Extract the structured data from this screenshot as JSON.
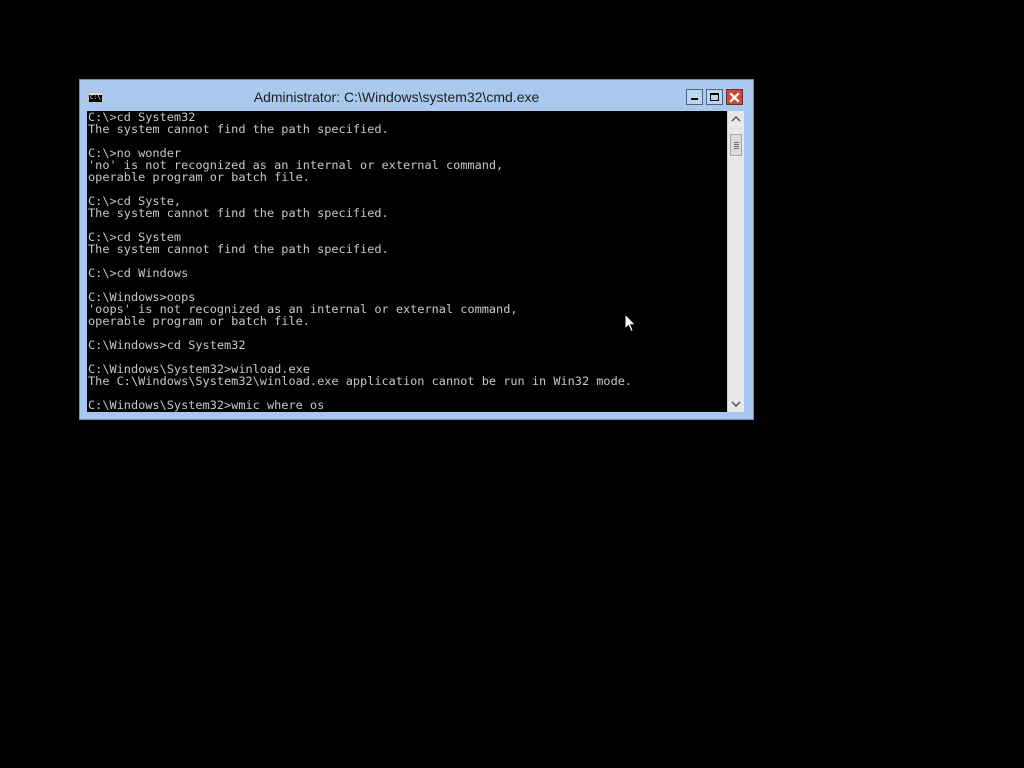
{
  "window": {
    "title": "Administrator: C:\\Windows\\system32\\cmd.exe",
    "icon_text": "C:\\"
  },
  "icons": {
    "app": "command-prompt-icon",
    "minimize": "minimize-icon",
    "maximize": "maximize-icon",
    "close": "close-icon",
    "scroll_up": "chevron-up-icon",
    "scroll_down": "chevron-down-icon",
    "cursor": "mouse-pointer-icon"
  },
  "colors": {
    "title_bar": "#a9caee",
    "close_button": "#c74a3a",
    "console_background": "#000000",
    "console_text": "#c8c8c8"
  },
  "console": {
    "lines": [
      "C:\\>cd System32",
      "The system cannot find the path specified.",
      "",
      "C:\\>no wonder",
      "'no' is not recognized as an internal or external command,",
      "operable program or batch file.",
      "",
      "C:\\>cd Syste,",
      "The system cannot find the path specified.",
      "",
      "C:\\>cd System",
      "The system cannot find the path specified.",
      "",
      "C:\\>cd Windows",
      "",
      "C:\\Windows>oops",
      "'oops' is not recognized as an internal or external command,",
      "operable program or batch file.",
      "",
      "C:\\Windows>cd System32",
      "",
      "C:\\Windows\\System32>winload.exe",
      "The C:\\Windows\\System32\\winload.exe application cannot be run in Win32 mode.",
      "",
      "C:\\Windows\\System32>wmic where os"
    ]
  }
}
